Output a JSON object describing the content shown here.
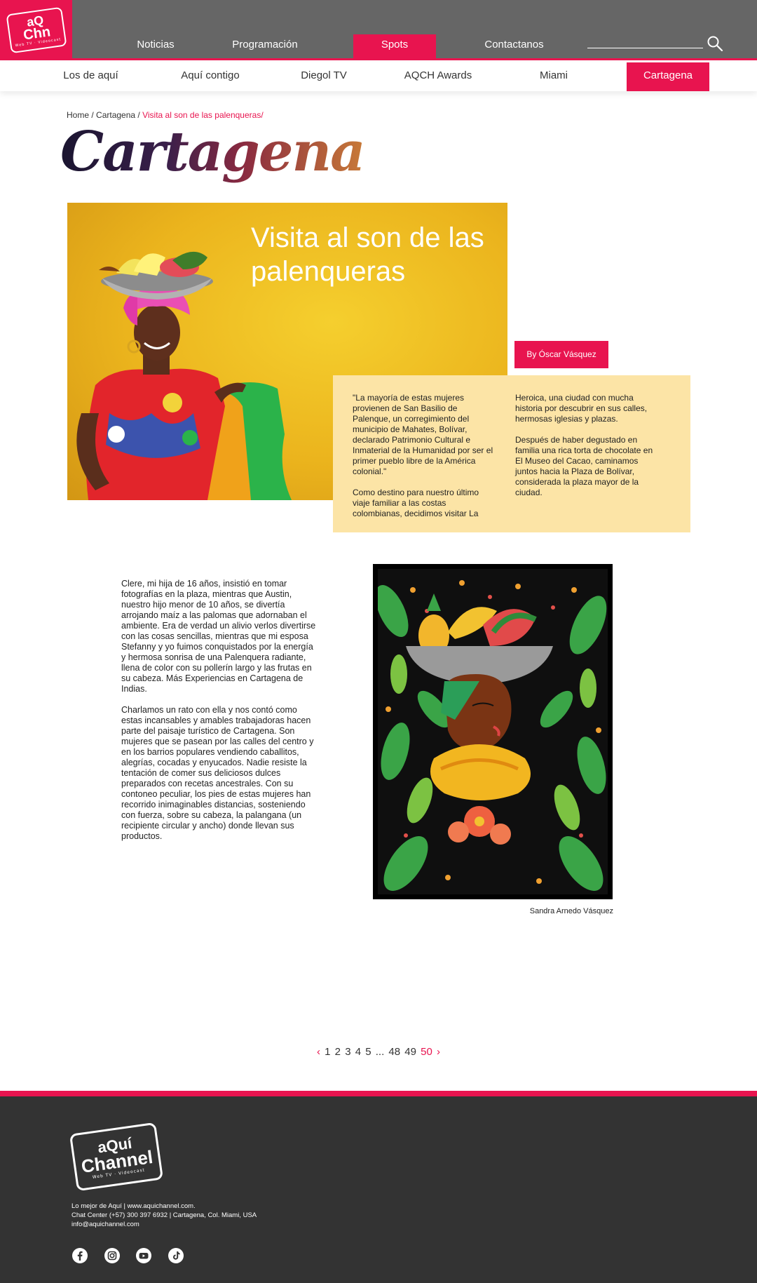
{
  "header": {
    "logo": {
      "line1": "aQ",
      "line2": "Chn",
      "tagline": "Web TV · Videocast"
    },
    "nav": [
      {
        "label": "Noticias"
      },
      {
        "label": "Programación"
      },
      {
        "label": "Spots",
        "active": true
      },
      {
        "label": "Contactanos"
      }
    ],
    "search": {
      "placeholder": "",
      "icon": "search-icon"
    },
    "accent": "#e8144f",
    "bar_color": "#666666"
  },
  "subnav": [
    {
      "label": "Los de aquí"
    },
    {
      "label": "Aquí contigo"
    },
    {
      "label": "Diegol TV"
    },
    {
      "label": "AQCH Awards"
    },
    {
      "label": "Miami"
    },
    {
      "label": "Cartagena",
      "active": true
    }
  ],
  "breadcrumb": {
    "home": "Home",
    "sep1": " / ",
    "section": "Cartagena",
    "sep2": " / ",
    "current": "Visita al son de las palenqueras/"
  },
  "page_title": "Cartagena",
  "hero": {
    "title": "Visita al son de las palenqueras",
    "byline": "By Óscar Vásquez"
  },
  "quote": {
    "col1_p1": "\"La mayoría de estas mujeres provienen de San Basilio de Palenque, un corregimiento del municipio de Mahates, Bolívar, declarado Patrimonio Cultural e Inmaterial de la Humanidad por ser el primer pueblo libre de la América colonial.\"",
    "col1_p2": "Como destino para nuestro último viaje familiar a las costas colombianas, decidimos visitar La",
    "col2_p1": "Heroica, una ciudad con mucha historia por descubrir en sus calles, hermosas iglesias y plazas.",
    "col2_p2": "Después de haber degustado en familia una rica torta de chocolate en El Museo del Cacao, caminamos juntos hacia la Plaza de Bolívar, considerada la plaza mayor de la ciudad."
  },
  "body": {
    "p1": "Clere, mi hija de 16 años, insistió en tomar fotografías en la plaza, mientras que Austin, nuestro hijo menor de 10 años, se divertía arrojando maíz a las palomas que adornaban el ambiente. Era de verdad un alivio verlos divertirse con las cosas sencillas, mientras que mi esposa Stefanny y yo fuimos conquistados por la energía y hermosa sonrisa de una Palenquera radiante, llena de color con su pollerín largo y las frutas en su cabeza. Más Experiencias en Cartagena de Indias.",
    "p2": "Charlamos un rato con ella y nos contó como estas incansables y amables trabajadoras hacen parte del paisaje turístico de Cartagena. Son mujeres que se pasean por las calles del centro y en los barrios populares vendiendo caballitos, alegrías, cocadas y enyucados. Nadie resiste la tentación de comer sus deliciosos dulces preparados con recetas ancestrales. Con su contoneo peculiar, los pies de estas mujeres han recorrido inimaginables distancias, sosteniendo con fuerza, sobre su cabeza, la palangana (un recipiente circular y ancho) donde llevan sus productos."
  },
  "art_caption": "Sandra Arnedo Vásquez",
  "pagination": {
    "prev": "‹",
    "pages": [
      "1",
      "2",
      "3",
      "4",
      "5"
    ],
    "ellipsis": "...",
    "tail": [
      "48",
      "49"
    ],
    "current": "50",
    "next": "›"
  },
  "footer": {
    "logo": {
      "line1": "aQuí",
      "line2": "Channel",
      "tagline": "Web TV · Videocast"
    },
    "line1": "Lo mejor de Aquí | www.aquichannel.com.",
    "line2": "Chat Center (+57) 300 397 6932 | Cartagena, Col. Miami, USA",
    "line3": "info@aquichannel.com",
    "social": [
      "facebook-icon",
      "instagram-icon",
      "youtube-icon",
      "tiktok-icon"
    ],
    "bg": "#333333"
  }
}
